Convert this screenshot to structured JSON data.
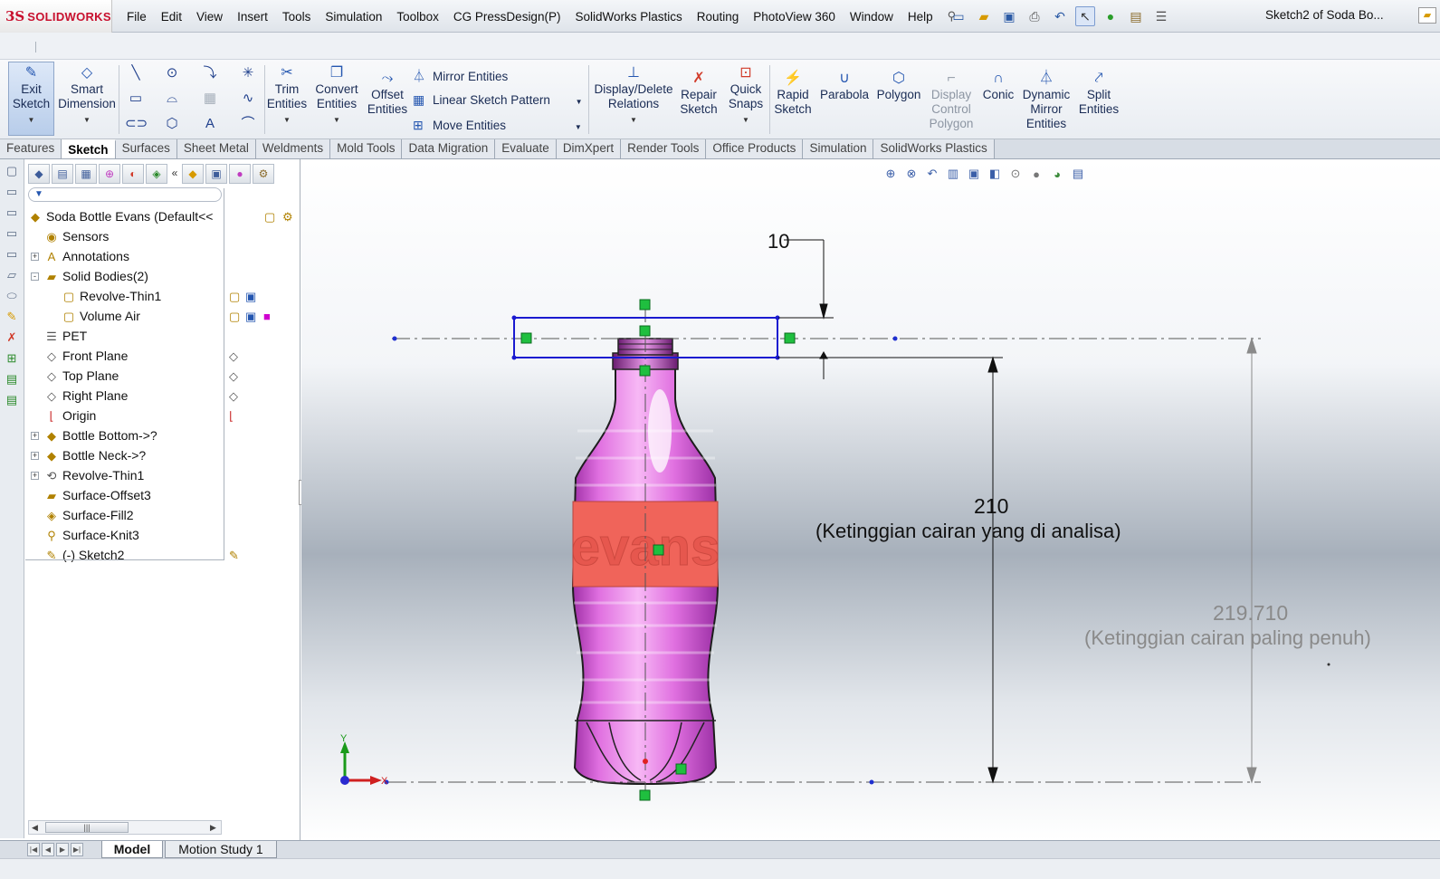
{
  "app": {
    "logo_mark": "3S",
    "logo_text": "SOLIDWORKS",
    "document_title": "Sketch2 of Soda Bo...",
    "menu": [
      "File",
      "Edit",
      "View",
      "Insert",
      "Tools",
      "Simulation",
      "Toolbox",
      "CG PressDesign(P)",
      "SolidWorks Plastics",
      "Routing",
      "PhotoView 360",
      "Window",
      "Help"
    ]
  },
  "command_manager": {
    "exit_sketch": [
      "Exit",
      "Sketch"
    ],
    "smart_dimension": [
      "Smart",
      "Dimension"
    ],
    "trim_entities": [
      "Trim",
      "Entities"
    ],
    "convert_entities": [
      "Convert",
      "Entities"
    ],
    "offset_entities": [
      "Offset",
      "Entities"
    ],
    "mirror_entities": "Mirror Entities",
    "linear_sketch_pattern": "Linear Sketch Pattern",
    "move_entities": "Move Entities",
    "display_delete_relations": [
      "Display/Delete",
      "Relations"
    ],
    "repair_sketch": [
      "Repair",
      "Sketch"
    ],
    "quick_snaps": [
      "Quick",
      "Snaps"
    ],
    "rapid_sketch": [
      "Rapid",
      "Sketch"
    ],
    "parabola": "Parabola",
    "polygon": "Polygon",
    "display_control_polygon": [
      "Display",
      "Control",
      "Polygon"
    ],
    "conic": "Conic",
    "dynamic_mirror_entities": [
      "Dynamic",
      "Mirror",
      "Entities"
    ],
    "split_entities": [
      "Split",
      "Entities"
    ]
  },
  "tabs": [
    "Features",
    "Sketch",
    "Surfaces",
    "Sheet Metal",
    "Weldments",
    "Mold Tools",
    "Data Migration",
    "Evaluate",
    "DimXpert",
    "Render Tools",
    "Office Products",
    "Simulation",
    "SolidWorks Plastics"
  ],
  "active_tab": "Sketch",
  "feature_tree": {
    "root": "Soda Bottle Evans  (Default<<",
    "items": [
      {
        "label": "Sensors",
        "level": 1,
        "expand": ""
      },
      {
        "label": "Annotations",
        "level": 1,
        "expand": "+"
      },
      {
        "label": "Solid Bodies(2)",
        "level": 1,
        "expand": "-"
      },
      {
        "label": "Revolve-Thin1",
        "level": 2,
        "expand": ""
      },
      {
        "label": "Volume Air",
        "level": 2,
        "expand": ""
      },
      {
        "label": "PET",
        "level": 1,
        "expand": ""
      },
      {
        "label": "Front Plane",
        "level": 1,
        "expand": ""
      },
      {
        "label": "Top Plane",
        "level": 1,
        "expand": ""
      },
      {
        "label": "Right Plane",
        "level": 1,
        "expand": ""
      },
      {
        "label": "Origin",
        "level": 1,
        "expand": ""
      },
      {
        "label": "Bottle Bottom->?",
        "level": 1,
        "expand": "+"
      },
      {
        "label": "Bottle Neck->?",
        "level": 1,
        "expand": "+"
      },
      {
        "label": "Revolve-Thin1",
        "level": 1,
        "expand": "+"
      },
      {
        "label": "Surface-Offset3",
        "level": 1,
        "expand": ""
      },
      {
        "label": "Surface-Fill2",
        "level": 1,
        "expand": ""
      },
      {
        "label": "Surface-Knit3",
        "level": 1,
        "expand": ""
      },
      {
        "label": "(-) Sketch2",
        "level": 1,
        "expand": ""
      }
    ]
  },
  "viewport": {
    "dim_top": "10",
    "dim_main": "210",
    "dim_main_note": "(Ketinggian cairan yang di analisa)",
    "dim_ref": "219.710",
    "dim_ref_note": "(Ketinggian cairan paling penuh)",
    "label_text": "evans",
    "axis_x": "X",
    "axis_y": "Y",
    "bottle_color": "#e070e0",
    "label_color": "#f0645a"
  },
  "bottom_tabs": {
    "model": "Model",
    "motion": "Motion Study 1"
  }
}
